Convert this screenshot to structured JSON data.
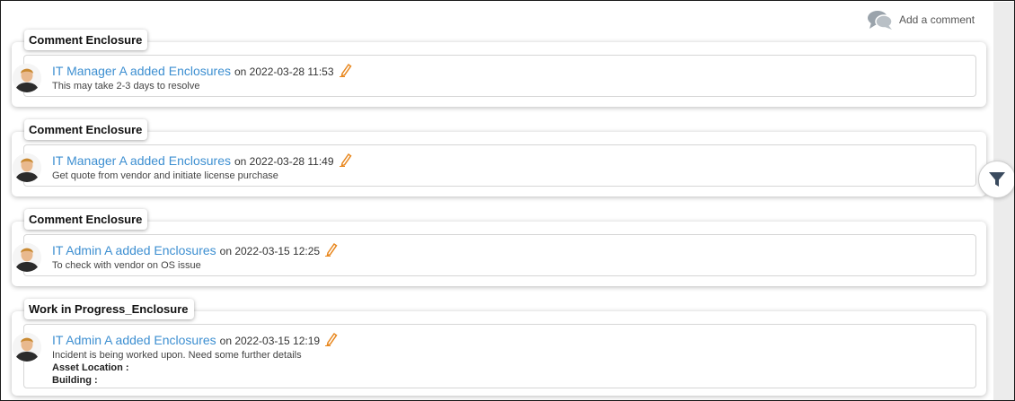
{
  "header": {
    "add_comment_label": "Add a comment",
    "add_comment_icon": "chat-bubbles-icon"
  },
  "entries": [
    {
      "tag": "Comment Enclosure",
      "author_action": "IT Manager A added Enclosures",
      "timestamp": "on 2022-03-28 11:53",
      "text": "This may take 2-3 days to resolve"
    },
    {
      "tag": "Comment Enclosure",
      "author_action": "IT Manager A added Enclosures",
      "timestamp": "on 2022-03-28 11:49",
      "text": "Get quote from vendor and initiate license purchase"
    },
    {
      "tag": "Comment Enclosure",
      "author_action": "IT Admin A added Enclosures",
      "timestamp": "on 2022-03-15 12:25",
      "text": "To check with vendor on OS issue"
    },
    {
      "tag": "Work in Progress_Enclosure",
      "author_action": "IT Admin A added Enclosures",
      "timestamp": "on 2022-03-15 12:19",
      "text": "Incident is being worked upon. Need some further details",
      "field1": "Asset Location :",
      "field2": "Building :"
    }
  ],
  "colors": {
    "link": "#3d8fd1",
    "pencil": "#e8871e",
    "filter_icon": "#3a4a5e"
  },
  "icons": {
    "edit": "pencil-icon",
    "filter": "filter-icon",
    "avatar": "user-avatar-icon"
  }
}
